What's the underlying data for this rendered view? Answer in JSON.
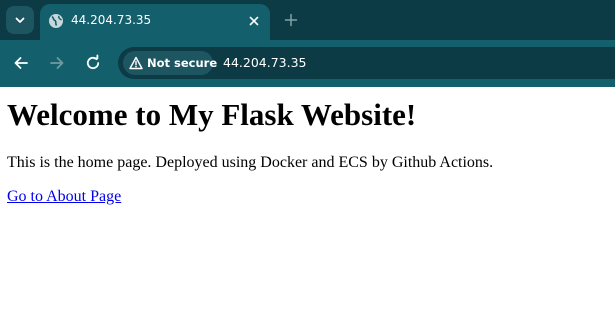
{
  "browser": {
    "tab": {
      "title": "44.204.73.35"
    },
    "toolbar": {
      "security_label": "Not secure",
      "url": "44.204.73.35"
    },
    "icons": {
      "tab_search": "chevron-down-icon",
      "favicon": "globe-icon",
      "tab_close": "close-icon",
      "new_tab": "plus-icon",
      "back": "arrow-left-icon",
      "forward": "arrow-right-icon",
      "reload": "reload-icon",
      "security": "warning-triangle-icon"
    },
    "colors": {
      "tabstrip_bg": "#0c3b46",
      "toolbar_bg": "#13606c",
      "omnibox_bg": "#0c3b46"
    }
  },
  "page": {
    "heading": "Welcome to My Flask Website!",
    "intro": "This is the home page. Deployed using Docker and ECS by Github Actions.",
    "about_link": "Go to About Page",
    "colors": {
      "link": "#0000ee"
    }
  }
}
